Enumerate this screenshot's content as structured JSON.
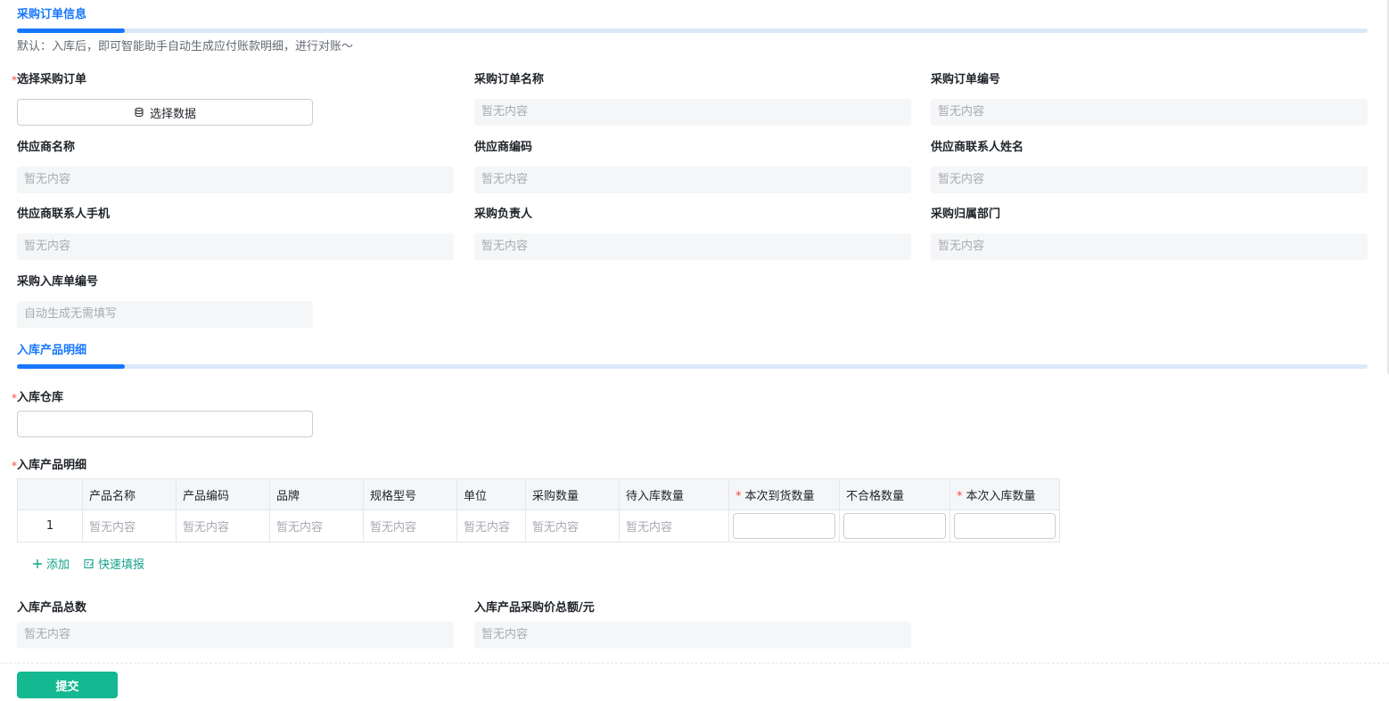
{
  "section1": {
    "title": "采购订单信息",
    "hint": "默认：入库后，即可智能助手自动生成应付账款明细，进行对账～"
  },
  "fields": {
    "select_order": {
      "label": "选择采购订单",
      "button_label": "选择数据"
    },
    "order_name": {
      "label": "采购订单名称",
      "value": "暂无内容"
    },
    "order_no": {
      "label": "采购订单编号",
      "value": "暂无内容"
    },
    "supplier_name": {
      "label": "供应商名称",
      "value": "暂无内容"
    },
    "supplier_code": {
      "label": "供应商编码",
      "value": "暂无内容"
    },
    "supplier_contact": {
      "label": "供应商联系人姓名",
      "value": "暂无内容"
    },
    "supplier_phone": {
      "label": "供应商联系人手机",
      "value": "暂无内容"
    },
    "purchaser": {
      "label": "采购负责人",
      "value": "暂无内容"
    },
    "department": {
      "label": "采购归属部门",
      "value": "暂无内容"
    },
    "receipt_no": {
      "label": "采购入库单编号",
      "value": "自动生成无需填写"
    }
  },
  "section2": {
    "title": "入库产品明细"
  },
  "warehouse": {
    "label": "入库仓库",
    "value": ""
  },
  "detail": {
    "label": "入库产品明细",
    "columns": [
      "",
      "产品名称",
      "产品编码",
      "品牌",
      "规格型号",
      "单位",
      "采购数量",
      "待入库数量",
      "本次到货数量",
      "不合格数量",
      "本次入库数量"
    ],
    "row": {
      "index": "1",
      "placeholder": "暂无内容"
    },
    "add_label": "添加",
    "quick_fill_label": "快速填报"
  },
  "totals": {
    "total_qty": {
      "label": "入库产品总数",
      "value": "暂无内容"
    },
    "total_amount": {
      "label": "入库产品采购价总额/元",
      "value": "暂无内容"
    }
  },
  "submit_label": "提交",
  "colors": {
    "accent": "#1677ff",
    "submit": "#14b891",
    "action": "#14a38b",
    "required": "#f54a45"
  }
}
